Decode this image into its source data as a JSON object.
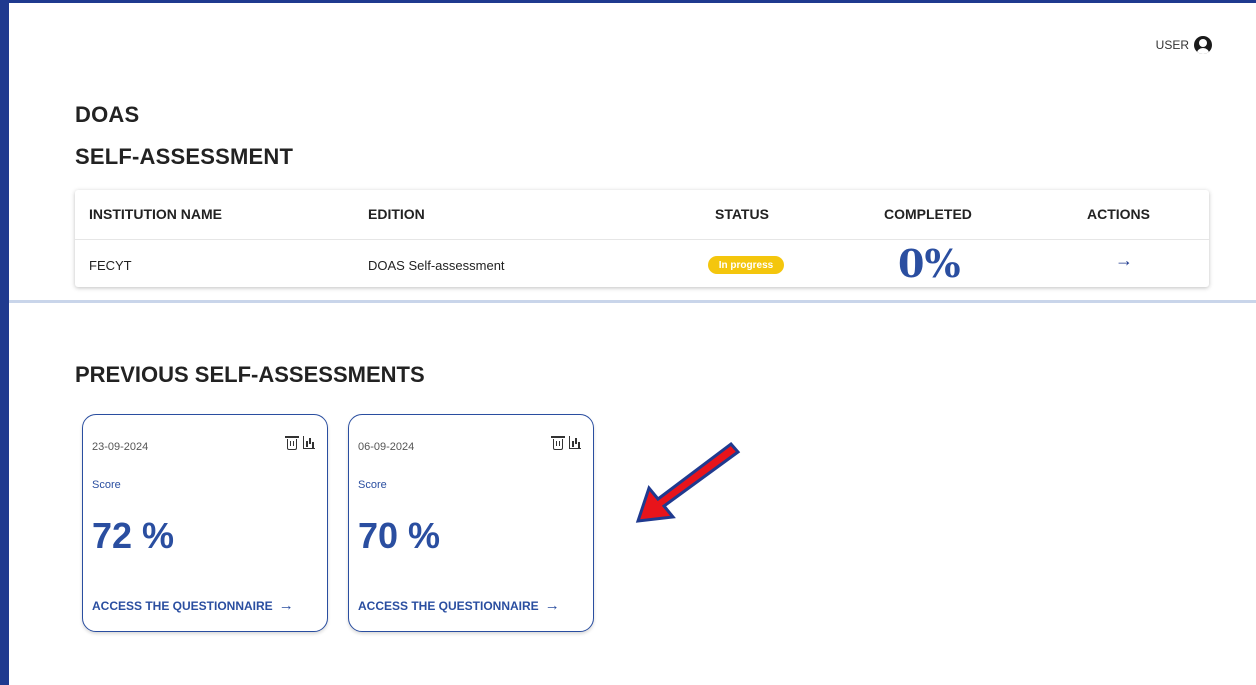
{
  "header": {
    "user_label": "USER"
  },
  "page": {
    "title_line1": "DOAS",
    "title_line2": "SELF-ASSESSMENT"
  },
  "table": {
    "columns": [
      "INSTITUTION NAME",
      "EDITION",
      "STATUS",
      "COMPLETED",
      "ACTIONS"
    ],
    "row": {
      "institution": "FECYT",
      "edition": "DOAS Self-assessment",
      "status": "In progress",
      "completed": "0%",
      "action_icon": "arrow-right-icon"
    }
  },
  "previous": {
    "title": "PREVIOUS SELF-ASSESSMENTS",
    "cards": [
      {
        "date": "23-09-2024",
        "score_label": "Score",
        "score": "72 %",
        "link": "ACCESS THE QUESTIONNAIRE"
      },
      {
        "date": "06-09-2024",
        "score_label": "Score",
        "score": "70 %",
        "link": "ACCESS THE QUESTIONNAIRE"
      }
    ]
  },
  "colors": {
    "accent": "#2a4ea0",
    "frame": "#1f3a8f",
    "status_badge": "#f4c60d",
    "annotation_arrow": "#e8141b"
  }
}
